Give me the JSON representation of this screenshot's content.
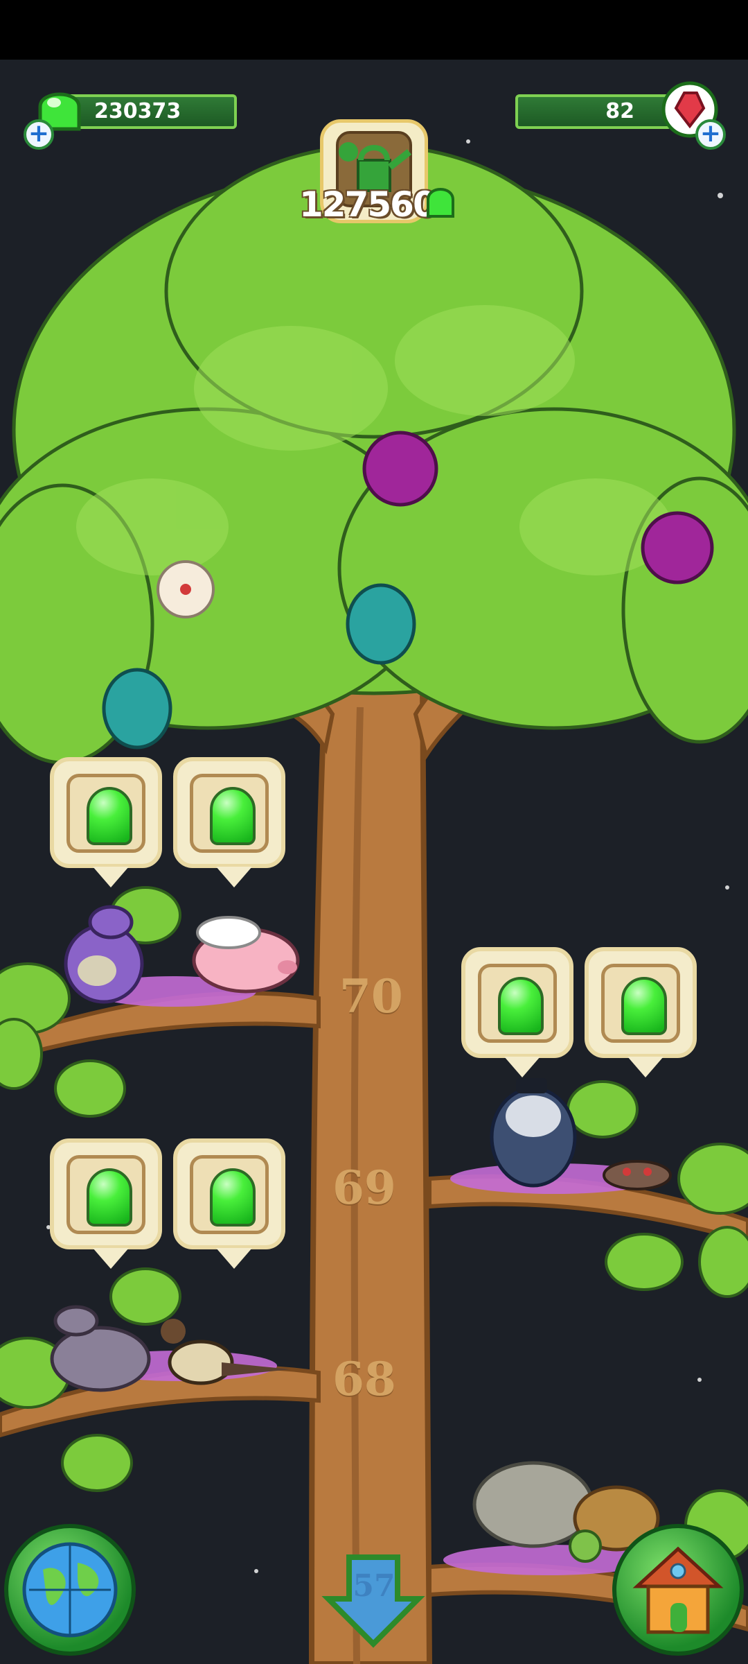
{
  "hud": {
    "gems_count": "230373",
    "crystals_count": "82",
    "watering_total": "127560"
  },
  "tree": {
    "levels": [
      "70",
      "69",
      "68"
    ],
    "down_arrow_level": "57"
  },
  "colors": {
    "gem_green": "#36e12b",
    "crystal_red": "#e23a48",
    "leaf_green": "#7ccb3c",
    "trunk_brown": "#b97a3f",
    "background": "#1c2027"
  },
  "icons": {
    "left_gem": "green-gem-icon",
    "right_gem": "red-crystal-icon",
    "watering": "watering-can-icon",
    "map": "globe-icon",
    "home": "house-icon",
    "down": "down-arrow-icon"
  }
}
